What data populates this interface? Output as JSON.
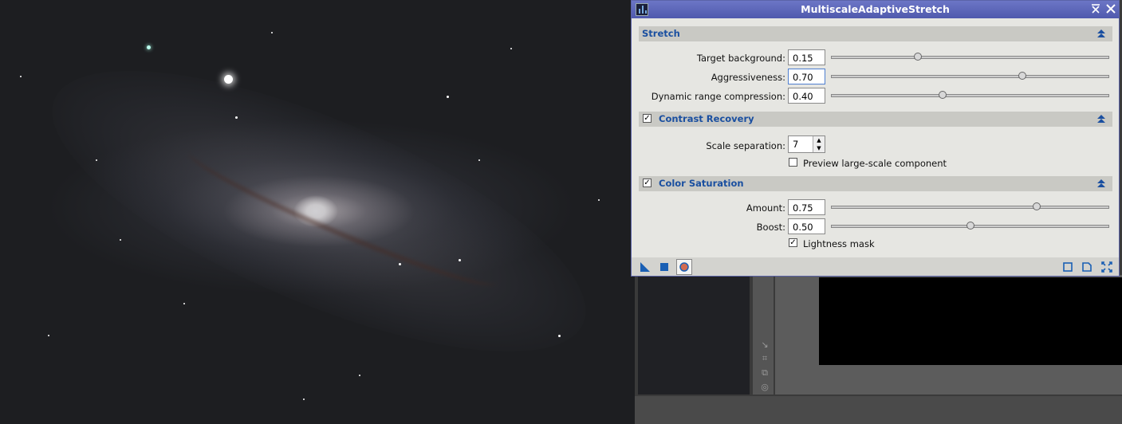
{
  "dialog": {
    "title": "MultiscaleAdaptiveStretch",
    "title_buttons": {
      "shade": "⨯̄",
      "close": "✕"
    },
    "stretch": {
      "header": "Stretch",
      "params": [
        {
          "label": "Target background:",
          "value": "0.15",
          "level": 0.31
        },
        {
          "label": "Aggressiveness:",
          "value": "0.70",
          "level": 0.69
        },
        {
          "label": "Dynamic range compression:",
          "value": "0.40",
          "level": 0.4
        }
      ]
    },
    "contrast": {
      "header": "Contrast Recovery",
      "checked": true,
      "scale_label": "Scale separation:",
      "scale_value": "7",
      "preview_label": "Preview large-scale component",
      "preview_checked": false
    },
    "saturation": {
      "header": "Color Saturation",
      "checked": true,
      "params": [
        {
          "label": "Amount:",
          "value": "0.75",
          "level": 0.74
        },
        {
          "label": "Boost:",
          "value": "0.50",
          "level": 0.5
        }
      ],
      "lightness_label": "Lightness mask",
      "lightness_checked": true
    },
    "footer_icons": [
      "new-instance-icon",
      "apply-global-icon",
      "real-time-preview-icon",
      "browse-docs-icon",
      "track-view-icon",
      "reset-icon"
    ]
  },
  "colors": {
    "title_bar": "#5b63b8",
    "section_text": "#1a4fa0",
    "dialog_bg": "#e6e6e2"
  }
}
